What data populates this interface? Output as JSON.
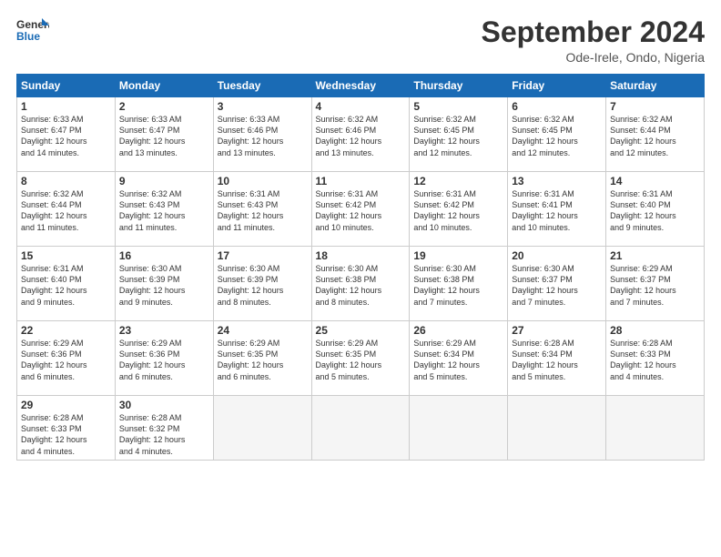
{
  "logo": {
    "line1": "General",
    "line2": "Blue"
  },
  "title": "September 2024",
  "location": "Ode-Irele, Ondo, Nigeria",
  "days_of_week": [
    "Sunday",
    "Monday",
    "Tuesday",
    "Wednesday",
    "Thursday",
    "Friday",
    "Saturday"
  ],
  "weeks": [
    [
      {
        "day": "1",
        "info": "Sunrise: 6:33 AM\nSunset: 6:47 PM\nDaylight: 12 hours\nand 14 minutes."
      },
      {
        "day": "2",
        "info": "Sunrise: 6:33 AM\nSunset: 6:47 PM\nDaylight: 12 hours\nand 13 minutes."
      },
      {
        "day": "3",
        "info": "Sunrise: 6:33 AM\nSunset: 6:46 PM\nDaylight: 12 hours\nand 13 minutes."
      },
      {
        "day": "4",
        "info": "Sunrise: 6:32 AM\nSunset: 6:46 PM\nDaylight: 12 hours\nand 13 minutes."
      },
      {
        "day": "5",
        "info": "Sunrise: 6:32 AM\nSunset: 6:45 PM\nDaylight: 12 hours\nand 12 minutes."
      },
      {
        "day": "6",
        "info": "Sunrise: 6:32 AM\nSunset: 6:45 PM\nDaylight: 12 hours\nand 12 minutes."
      },
      {
        "day": "7",
        "info": "Sunrise: 6:32 AM\nSunset: 6:44 PM\nDaylight: 12 hours\nand 12 minutes."
      }
    ],
    [
      {
        "day": "8",
        "info": "Sunrise: 6:32 AM\nSunset: 6:44 PM\nDaylight: 12 hours\nand 11 minutes."
      },
      {
        "day": "9",
        "info": "Sunrise: 6:32 AM\nSunset: 6:43 PM\nDaylight: 12 hours\nand 11 minutes."
      },
      {
        "day": "10",
        "info": "Sunrise: 6:31 AM\nSunset: 6:43 PM\nDaylight: 12 hours\nand 11 minutes."
      },
      {
        "day": "11",
        "info": "Sunrise: 6:31 AM\nSunset: 6:42 PM\nDaylight: 12 hours\nand 10 minutes."
      },
      {
        "day": "12",
        "info": "Sunrise: 6:31 AM\nSunset: 6:42 PM\nDaylight: 12 hours\nand 10 minutes."
      },
      {
        "day": "13",
        "info": "Sunrise: 6:31 AM\nSunset: 6:41 PM\nDaylight: 12 hours\nand 10 minutes."
      },
      {
        "day": "14",
        "info": "Sunrise: 6:31 AM\nSunset: 6:40 PM\nDaylight: 12 hours\nand 9 minutes."
      }
    ],
    [
      {
        "day": "15",
        "info": "Sunrise: 6:31 AM\nSunset: 6:40 PM\nDaylight: 12 hours\nand 9 minutes."
      },
      {
        "day": "16",
        "info": "Sunrise: 6:30 AM\nSunset: 6:39 PM\nDaylight: 12 hours\nand 9 minutes."
      },
      {
        "day": "17",
        "info": "Sunrise: 6:30 AM\nSunset: 6:39 PM\nDaylight: 12 hours\nand 8 minutes."
      },
      {
        "day": "18",
        "info": "Sunrise: 6:30 AM\nSunset: 6:38 PM\nDaylight: 12 hours\nand 8 minutes."
      },
      {
        "day": "19",
        "info": "Sunrise: 6:30 AM\nSunset: 6:38 PM\nDaylight: 12 hours\nand 7 minutes."
      },
      {
        "day": "20",
        "info": "Sunrise: 6:30 AM\nSunset: 6:37 PM\nDaylight: 12 hours\nand 7 minutes."
      },
      {
        "day": "21",
        "info": "Sunrise: 6:29 AM\nSunset: 6:37 PM\nDaylight: 12 hours\nand 7 minutes."
      }
    ],
    [
      {
        "day": "22",
        "info": "Sunrise: 6:29 AM\nSunset: 6:36 PM\nDaylight: 12 hours\nand 6 minutes."
      },
      {
        "day": "23",
        "info": "Sunrise: 6:29 AM\nSunset: 6:36 PM\nDaylight: 12 hours\nand 6 minutes."
      },
      {
        "day": "24",
        "info": "Sunrise: 6:29 AM\nSunset: 6:35 PM\nDaylight: 12 hours\nand 6 minutes."
      },
      {
        "day": "25",
        "info": "Sunrise: 6:29 AM\nSunset: 6:35 PM\nDaylight: 12 hours\nand 5 minutes."
      },
      {
        "day": "26",
        "info": "Sunrise: 6:29 AM\nSunset: 6:34 PM\nDaylight: 12 hours\nand 5 minutes."
      },
      {
        "day": "27",
        "info": "Sunrise: 6:28 AM\nSunset: 6:34 PM\nDaylight: 12 hours\nand 5 minutes."
      },
      {
        "day": "28",
        "info": "Sunrise: 6:28 AM\nSunset: 6:33 PM\nDaylight: 12 hours\nand 4 minutes."
      }
    ],
    [
      {
        "day": "29",
        "info": "Sunrise: 6:28 AM\nSunset: 6:33 PM\nDaylight: 12 hours\nand 4 minutes."
      },
      {
        "day": "30",
        "info": "Sunrise: 6:28 AM\nSunset: 6:32 PM\nDaylight: 12 hours\nand 4 minutes."
      },
      null,
      null,
      null,
      null,
      null
    ]
  ]
}
